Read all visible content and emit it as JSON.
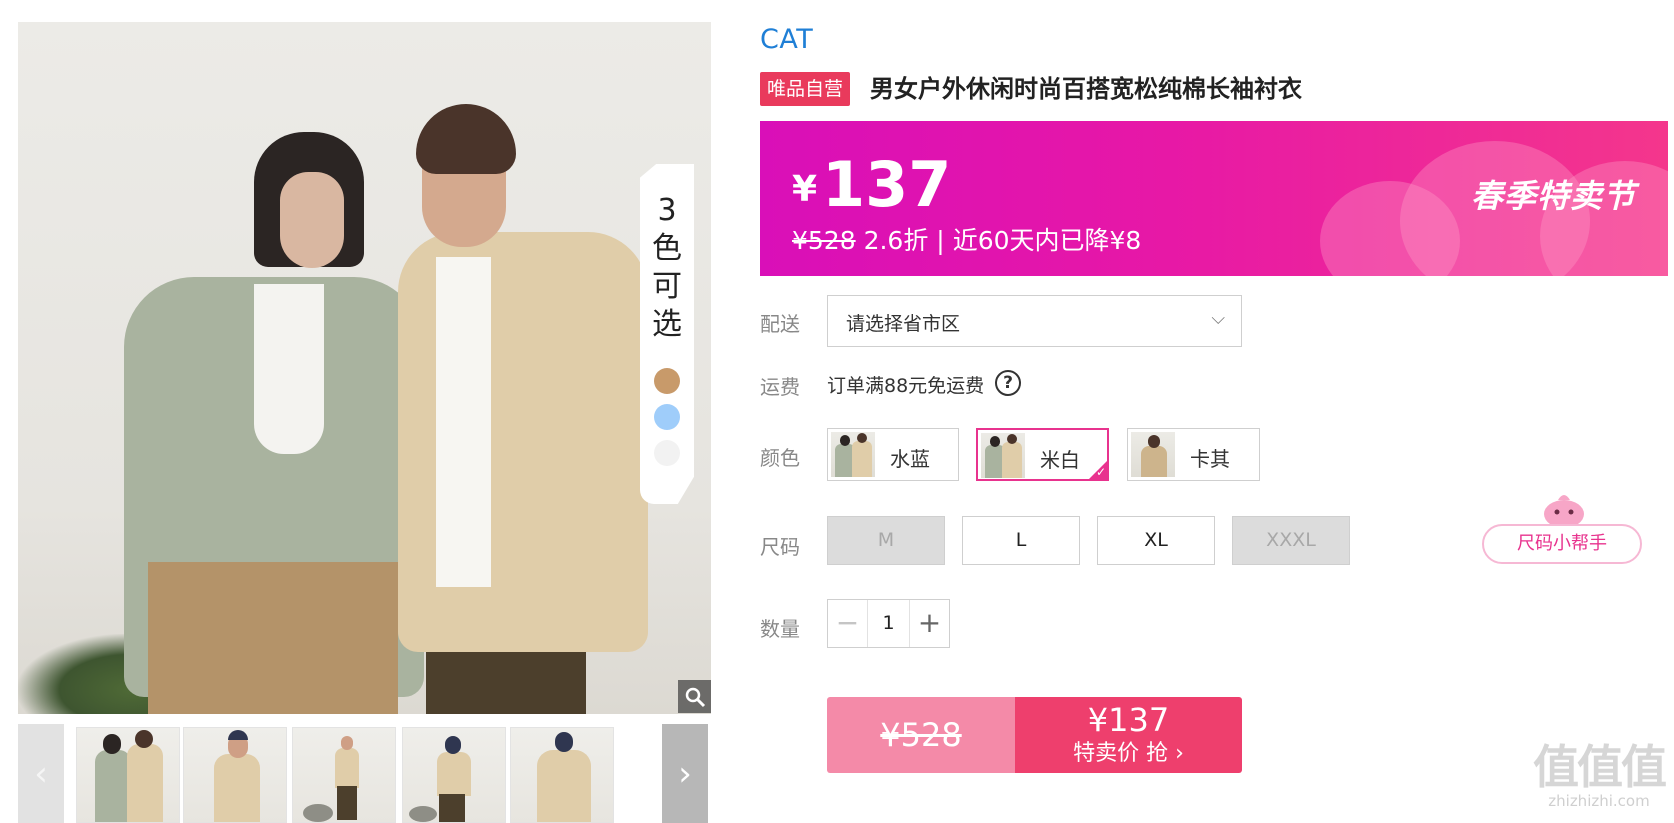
{
  "gallery": {
    "color_tag": {
      "count": "3",
      "text_line1": "色",
      "text_line2": "可",
      "text_line3": "选"
    },
    "swatches": [
      "#c89a6a",
      "#9fcdfa",
      "#f2f2f2"
    ],
    "zoom_icon": "magnifier-icon",
    "prev_icon": "chevron-left-icon",
    "next_icon": "chevron-right-icon",
    "next_glyph": "›",
    "prev_glyph": "‹"
  },
  "product": {
    "brand": "CAT",
    "badge": "唯品自营",
    "title": "男女户外休闲时尚百搭宽松纯棉长袖衬衣"
  },
  "price": {
    "currency": "¥",
    "current": "137",
    "original": "¥528",
    "discount": "2.6折",
    "separator": "|",
    "drop_note": "近60天内已降¥8",
    "event": "春季特卖节"
  },
  "delivery": {
    "label": "配送",
    "placeholder": "请选择省市区",
    "chevron": "⌵"
  },
  "shipping": {
    "label": "运费",
    "text": "订单满88元免运费",
    "help": "?"
  },
  "colors": {
    "label": "颜色",
    "options": [
      {
        "name": "水蓝",
        "selected": false
      },
      {
        "name": "米白",
        "selected": true
      },
      {
        "name": "卡其",
        "selected": false
      }
    ]
  },
  "sizes": {
    "label": "尺码",
    "options": [
      {
        "name": "M",
        "available": false
      },
      {
        "name": "L",
        "available": true
      },
      {
        "name": "XL",
        "available": true
      },
      {
        "name": "XXXL",
        "available": false
      }
    ],
    "helper": "尺码小帮手"
  },
  "quantity": {
    "label": "数量",
    "value": "1",
    "minus": "−",
    "plus": "+"
  },
  "buy": {
    "original": "¥528",
    "price": "¥137",
    "action": "特卖价 抢 ›"
  },
  "watermark": {
    "big": "值值值",
    "small": "zhizhizhi.com"
  },
  "colors_theme": {
    "accent": "#e8338e",
    "brand_blue": "#1f7fd6",
    "badge_red": "#e93a5c"
  }
}
